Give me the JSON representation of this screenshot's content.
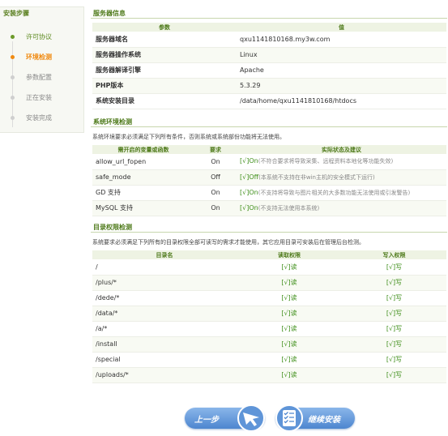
{
  "sidebar": {
    "title": "安装步骤",
    "steps": [
      {
        "label": "许可协议",
        "state": "done"
      },
      {
        "label": "环境检测",
        "state": "active"
      },
      {
        "label": "参数配置",
        "state": "todo"
      },
      {
        "label": "正在安装",
        "state": "todo"
      },
      {
        "label": "安装完成",
        "state": "todo"
      }
    ]
  },
  "server_info": {
    "title": "服务器信息",
    "headers": [
      "参数",
      "值"
    ],
    "rows": [
      {
        "param": "服务器域名",
        "value": "qxu1141810168.my3w.com"
      },
      {
        "param": "服务器操作系统",
        "value": "Linux"
      },
      {
        "param": "服务器解译引擎",
        "value": "Apache"
      },
      {
        "param": "PHP版本",
        "value": "5.3.29"
      },
      {
        "param": "系统安装目录",
        "value": "/data/home/qxu1141810168/htdocs"
      }
    ]
  },
  "env_check": {
    "title": "系统环境检测",
    "desc": "系统环境要求必须满足下列所有条件，否则系统或系统部份功能将无法使用。",
    "headers": [
      "需开启的变量或函数",
      "要求",
      "实际状态及建议"
    ],
    "rows": [
      {
        "name": "allow_url_fopen",
        "req": "On",
        "status": "[√]On",
        "hint": "(不符合要求将导致采集、远程资料本地化等功能失效)"
      },
      {
        "name": "safe_mode",
        "req": "Off",
        "status": "[√]Off",
        "hint": "(本系统不支持在非win主机的安全模式下运行)"
      },
      {
        "name": "GD 支持",
        "req": "On",
        "status": "[√]On",
        "hint": "(不支持将导致与图片相关的大多数功能无法使用或引发警告)"
      },
      {
        "name": "MySQL 支持",
        "req": "On",
        "status": "[√]On",
        "hint": "(不支持无法使用本系统)"
      }
    ]
  },
  "dir_check": {
    "title": "目录权限检测",
    "desc": "系统要求必须满足下列所有的目录权限全部可读写的需求才能使用，其它应用目录可安装后在管理后台检测。",
    "headers": [
      "目录名",
      "读取权限",
      "写入权限"
    ],
    "rows": [
      {
        "dir": "/",
        "read": "[√]读",
        "write": "[√]写"
      },
      {
        "dir": "/plus/*",
        "read": "[√]读",
        "write": "[√]写"
      },
      {
        "dir": "/dede/*",
        "read": "[√]读",
        "write": "[√]写"
      },
      {
        "dir": "/data/*",
        "read": "[√]读",
        "write": "[√]写"
      },
      {
        "dir": "/a/*",
        "read": "[√]读",
        "write": "[√]写"
      },
      {
        "dir": "/install",
        "read": "[√]读",
        "write": "[√]写"
      },
      {
        "dir": "/special",
        "read": "[√]读",
        "write": "[√]写"
      },
      {
        "dir": "/uploads/*",
        "read": "[√]读",
        "write": "[√]写"
      }
    ]
  },
  "buttons": {
    "prev": "上一步",
    "next": "继续安装",
    "prev_icon": "pointer-arrow-icon",
    "next_icon": "checklist-icon"
  },
  "colors": {
    "accent_green": "#4e7a1a",
    "active_orange": "#f08a11",
    "button_blue": "#4d86cf"
  }
}
